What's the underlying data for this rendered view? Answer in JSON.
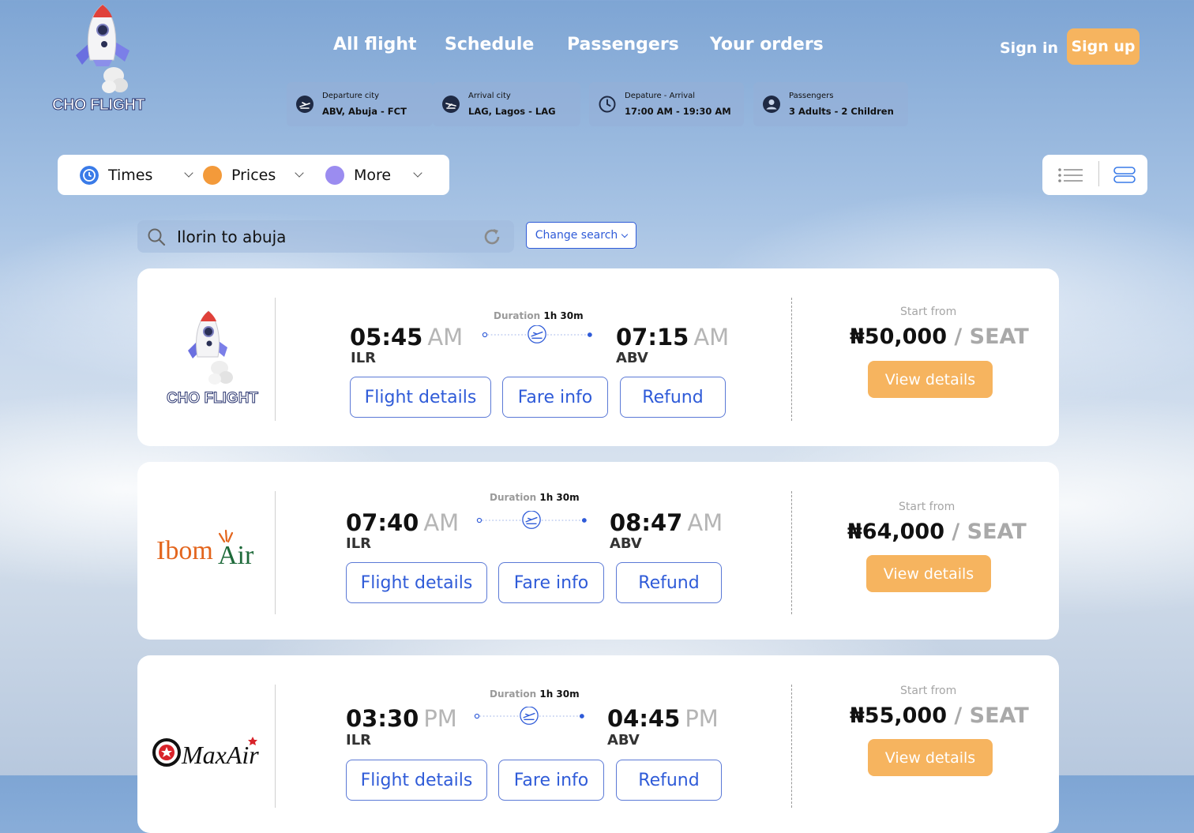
{
  "brand": {
    "name": "CHO FLIGHT"
  },
  "nav": {
    "items": [
      "All flight",
      "Schedule",
      "Passengers",
      "Your orders"
    ],
    "signin": "Sign in",
    "signup": "Sign up"
  },
  "search_chips": [
    {
      "label": "Departure city",
      "value": "ABV, Abuja - FCT",
      "icon": "departure-plane-icon"
    },
    {
      "label": "Arrival city",
      "value": "LAG, Lagos - LAG",
      "icon": "arrival-plane-icon"
    },
    {
      "label": "Depature - Arrival",
      "value": "17:00 AM - 19:30 AM",
      "icon": "clock-icon"
    },
    {
      "label": "Passengers",
      "value": "3 Adults - 2 Children",
      "icon": "user-icon"
    }
  ],
  "filters": [
    {
      "label": "Times",
      "color": "#3a7be8"
    },
    {
      "label": "Prices",
      "color": "#f39a3a"
    },
    {
      "label": "More",
      "color": "#9b8cf0"
    }
  ],
  "search": {
    "query": "Ilorin to abuja",
    "change_label": "Change search"
  },
  "flights": [
    {
      "airline": "CHO FLIGHT",
      "duration_label": "Duration",
      "duration": "1h 30m",
      "dep_time": "05:45",
      "dep_ampm": "AM",
      "dep_code": "ILR",
      "arr_time": "07:15",
      "arr_ampm": "AM",
      "arr_code": "ABV",
      "btn_details": "Flight details",
      "btn_fare": "Fare info",
      "btn_refund": "Refund",
      "start_from": "Start from",
      "price": "₦50,000",
      "per": "/ SEAT",
      "view": "View details"
    },
    {
      "airline": "Ibom Air",
      "duration_label": "Duration",
      "duration": "1h 30m",
      "dep_time": "07:40",
      "dep_ampm": "AM",
      "dep_code": "ILR",
      "arr_time": "08:47",
      "arr_ampm": "AM",
      "arr_code": "ABV",
      "btn_details": "Flight details",
      "btn_fare": "Fare info",
      "btn_refund": "Refund",
      "start_from": "Start from",
      "price": "₦64,000",
      "per": "/ SEAT",
      "view": "View details"
    },
    {
      "airline": "MaxAir",
      "duration_label": "Duration",
      "duration": "1h 30m",
      "dep_time": "03:30",
      "dep_ampm": "PM",
      "dep_code": "ILR",
      "arr_time": "04:45",
      "arr_ampm": "PM",
      "arr_code": "ABV",
      "btn_details": "Flight details",
      "btn_fare": "Fare info",
      "btn_refund": "Refund",
      "start_from": "Start from",
      "price": "₦55,000",
      "per": "/ SEAT",
      "view": "View details"
    }
  ],
  "colors": {
    "accent": "#f6b45f",
    "primary_blue": "#2f5bd8"
  }
}
